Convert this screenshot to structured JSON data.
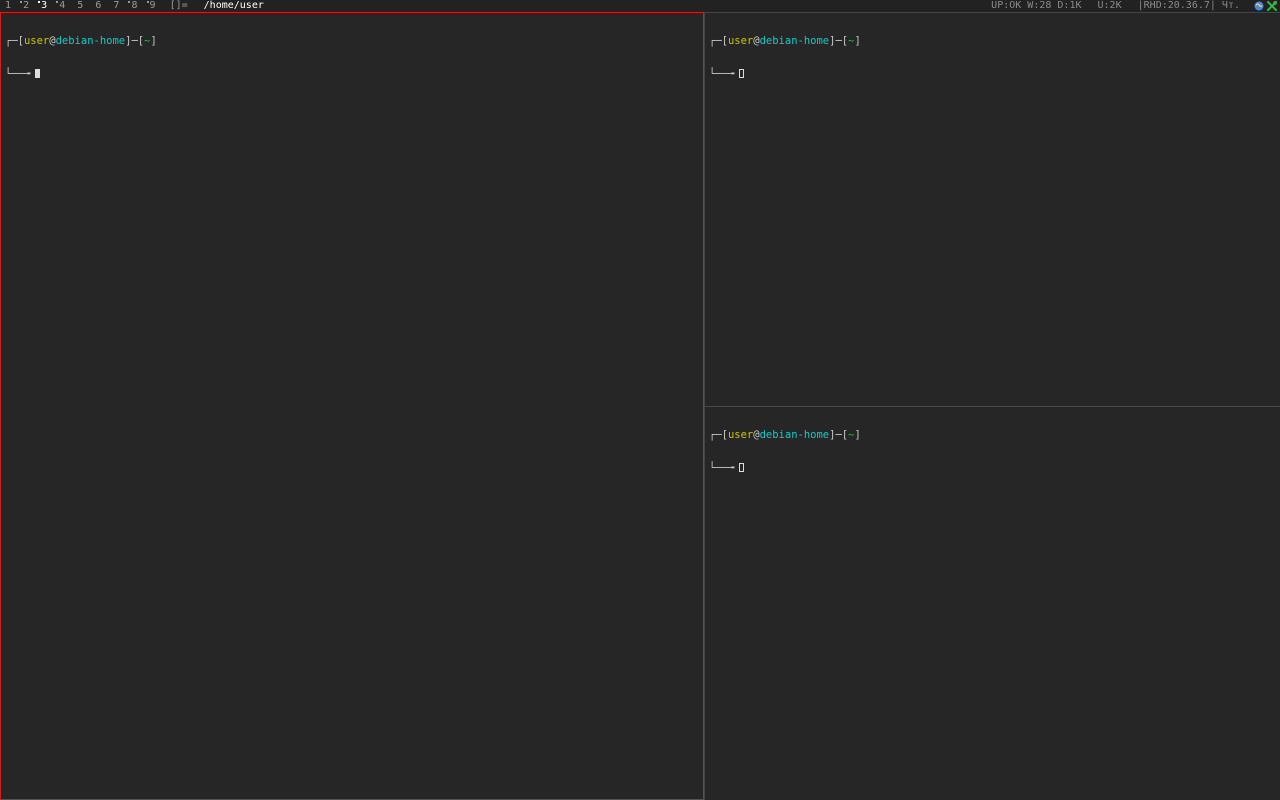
{
  "bar": {
    "workspaces": [
      {
        "label": "1",
        "occupied": false,
        "current": false
      },
      {
        "label": "2",
        "occupied": true,
        "current": false
      },
      {
        "label": "3",
        "occupied": true,
        "current": true
      },
      {
        "label": "4",
        "occupied": true,
        "current": false
      },
      {
        "label": "5",
        "occupied": false,
        "current": false
      },
      {
        "label": "6",
        "occupied": false,
        "current": false
      },
      {
        "label": "7",
        "occupied": false,
        "current": false
      },
      {
        "label": "8",
        "occupied": true,
        "current": false
      },
      {
        "label": "9",
        "occupied": true,
        "current": false
      }
    ],
    "layout_symbol": "[]=",
    "title": "/home/user",
    "status": {
      "uptime": "UP:OK W:28 D:1K",
      "upload": "U:2K",
      "clock": "|RHD:20.36.7| Чт."
    },
    "tray_icons": [
      "network-globe-icon",
      "tools-icon"
    ]
  },
  "colors": {
    "focused_border": "#cc1f1f",
    "user": "#c8c800",
    "host": "#18c8c8",
    "dir": "#18c818",
    "background": "#262626"
  },
  "terminals": {
    "main": {
      "frame_open": "┌─[",
      "user": "user",
      "at": "@",
      "host": "debian-home",
      "mid": "]─[",
      "dir": "~",
      "close": "]",
      "prompt": "└──╼",
      "focused": true
    },
    "top": {
      "frame_open": "┌─[",
      "user": "user",
      "at": "@",
      "host": "debian-home",
      "mid": "]─[",
      "dir": "~",
      "close": "]",
      "prompt": "└──╼",
      "focused": false
    },
    "bottom": {
      "frame_open": "┌─[",
      "user": "user",
      "at": "@",
      "host": "debian-home",
      "mid": "]─[",
      "dir": "~",
      "close": "]",
      "prompt": "└──╼",
      "focused": false
    }
  }
}
